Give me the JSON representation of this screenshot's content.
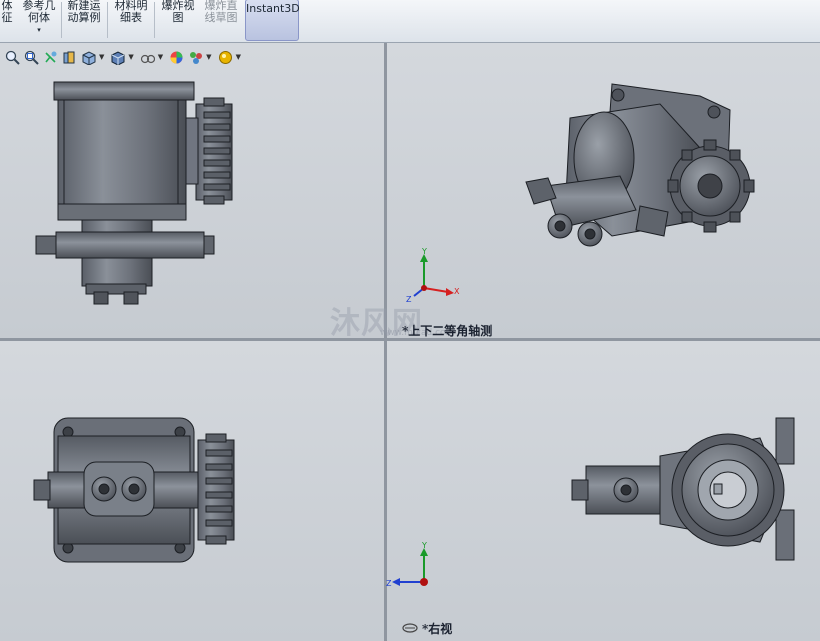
{
  "ribbon": {
    "items": [
      {
        "label": "体\n征",
        "disabled": false
      },
      {
        "label": "参考几\n何体",
        "disabled": false,
        "dropdown": true
      },
      {
        "label": "新建运\n动算例",
        "disabled": false
      },
      {
        "label": "材料明\n细表",
        "disabled": false
      },
      {
        "label": "爆炸视\n图",
        "disabled": false
      },
      {
        "label": "爆炸直\n线草图",
        "disabled": true
      },
      {
        "label": "Instant3D",
        "disabled": false,
        "active": true
      }
    ]
  },
  "hud_toolbar": {
    "icons": [
      "zoom-to-fit-icon",
      "zoom-area-icon",
      "previous-view-icon",
      "section-view-icon",
      "view-orientation-icon",
      "display-style-icon",
      "hide-show-icon",
      "edit-appearance-icon",
      "apply-scene-icon",
      "view-settings-icon"
    ]
  },
  "viewports": {
    "top_right_label": "*上下二等角轴测",
    "bottom_right_label": "*右视"
  },
  "watermark": {
    "text": "沐风网",
    "url": "www.mfcad.com"
  },
  "triad": {
    "x": "X",
    "y": "Y",
    "z": "Z",
    "colors": {
      "x": "#d62020",
      "y": "#1a9a2a",
      "z": "#2040d0"
    }
  }
}
